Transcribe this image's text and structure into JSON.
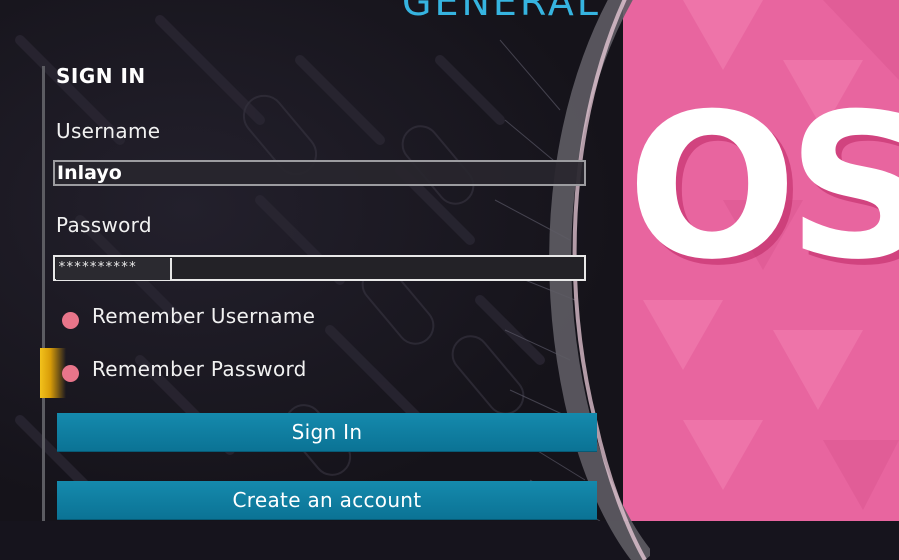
{
  "header": {
    "section_title": "GENERAL"
  },
  "background": {
    "brand_text": "OS"
  },
  "signin": {
    "title": "SIGN IN",
    "username_label": "Username",
    "username_value": "Inlayo",
    "password_label": "Password",
    "password_value": "**********",
    "remember_username": "Remember Username",
    "remember_password": "Remember Password",
    "sign_in_button": "Sign In",
    "create_account_button": "Create an account"
  },
  "colors": {
    "accent_blue": "#36b4e0",
    "button_blue": "#0f80a3",
    "pink": "#e8659f",
    "radio_pink": "#e8758a",
    "focus_gold": "#f3c21c"
  }
}
